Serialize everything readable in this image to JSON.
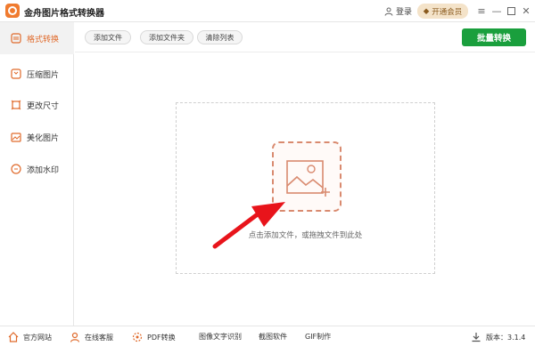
{
  "app": {
    "title": "金舟图片格式转换器",
    "login_label": "登录",
    "member_label": "开通会员"
  },
  "sidebar": {
    "items": [
      {
        "label": "格式转换",
        "icon": "format-convert-icon",
        "active": true
      },
      {
        "label": "压缩图片",
        "icon": "compress-icon"
      },
      {
        "label": "更改尺寸",
        "icon": "resize-icon"
      },
      {
        "label": "美化图片",
        "icon": "beautify-icon"
      },
      {
        "label": "添加水印",
        "icon": "watermark-icon"
      }
    ]
  },
  "toolbar": {
    "add_file": "添加文件",
    "add_folder": "添加文件夹",
    "clear_list": "清除列表",
    "batch_convert": "批量转换"
  },
  "dropzone": {
    "hint": "点击添加文件，或拖拽文件到此处",
    "add_icon": "add-image-icon"
  },
  "footer": {
    "items": [
      {
        "label": "官方网站",
        "icon": "home-icon"
      },
      {
        "label": "在线客服",
        "icon": "support-icon"
      },
      {
        "label": "PDF转换",
        "icon": "pdf-icon"
      },
      {
        "label": "图像文字识别",
        "icon": "ocr-icon"
      },
      {
        "label": "截图软件",
        "icon": "screenshot-icon"
      },
      {
        "label": "GIF制作",
        "icon": "gif-icon"
      }
    ],
    "version": "版本：3.1.4"
  },
  "colors": {
    "accent": "#e06a2b",
    "primary": "#1a9f3d",
    "member_bg": "#f4e3c9",
    "arrow": "#e8141b"
  }
}
